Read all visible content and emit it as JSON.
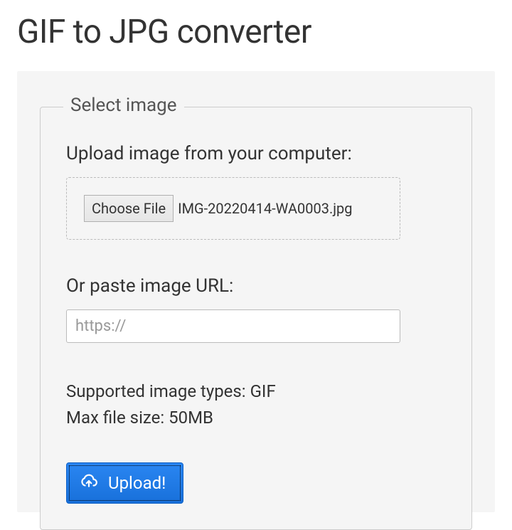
{
  "title": "GIF to JPG converter",
  "form": {
    "legend": "Select image",
    "upload_heading": "Upload image from your computer:",
    "choose_file_label": "Choose File",
    "selected_filename": "IMG-20220414-WA0003.jpg",
    "url_heading": "Or paste image URL:",
    "url_placeholder": "https://",
    "url_value": "",
    "supported_line": "Supported image types: GIF",
    "maxsize_line": "Max file size: 50MB",
    "upload_button_label": "Upload!"
  }
}
